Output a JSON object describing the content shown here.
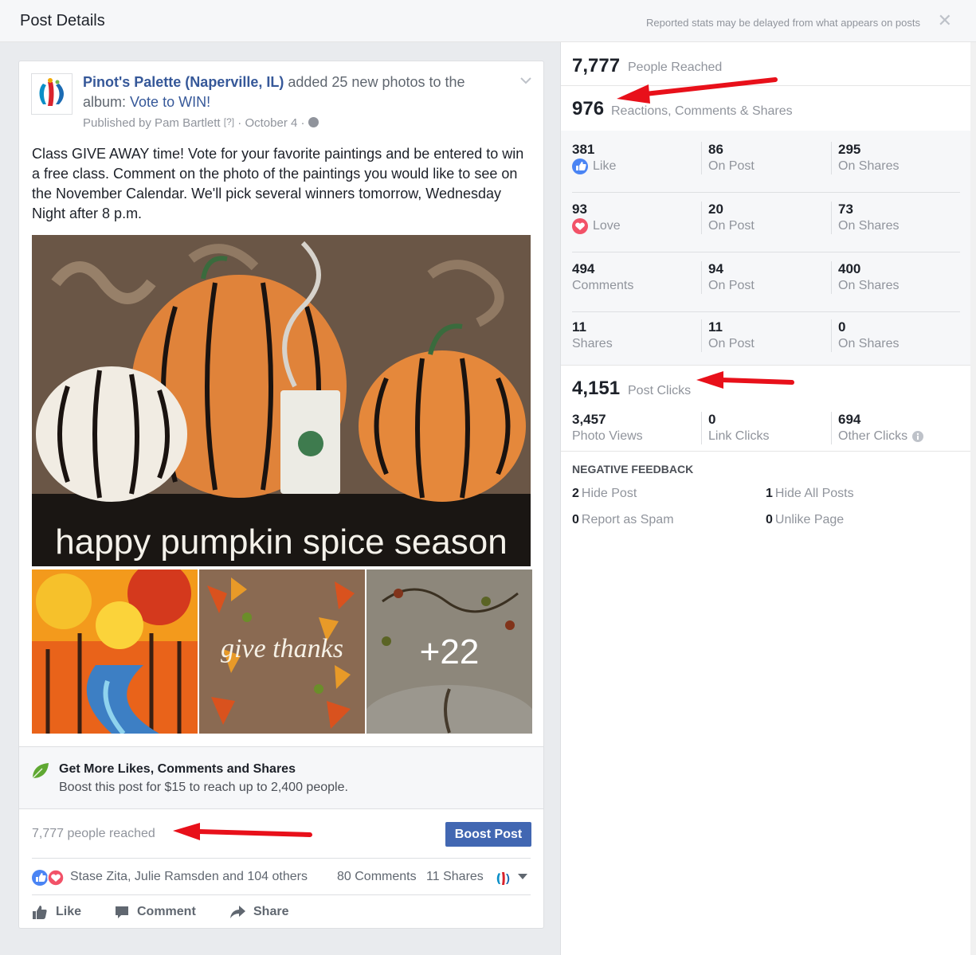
{
  "dialog": {
    "title": "Post Details",
    "note": "Reported stats may be delayed from what appears on posts",
    "close_glyph": "✕"
  },
  "post": {
    "page_name": "Pinot's Palette (Naperville, IL)",
    "action_text": " added 25 new photos to the album: ",
    "album_name": "Vote to WIN!",
    "published_by": "Published by Pam Bartlett",
    "help_mark": "[?]",
    "date": "October 4",
    "body": "Class GIVE AWAY time! Vote for your favorite paintings and be entered to win a free class. Comment on the photo of the paintings you would like to see on the November Calendar. We'll pick several winners tomorrow, Wednesday Night after 8 p.m.",
    "photo_main_caption": "happy pumpkin spice season",
    "photo_thumb2_caption": "give thanks",
    "more_photos": "+22",
    "boost_title": "Get More Likes, Comments and Shares",
    "boost_sub": "Boost this post for $15 to reach up to 2,400 people.",
    "reach": "7,777 people reached",
    "boost_button": "Boost Post",
    "reaction_names": "Stase Zita, Julie Ramsden and 104 others",
    "comments_count": "80 Comments",
    "shares_count": "11 Shares",
    "actions": {
      "like": "Like",
      "comment": "Comment",
      "share": "Share"
    }
  },
  "stats": {
    "reached": {
      "value": "7,777",
      "label": "People Reached"
    },
    "engagement": {
      "value": "976",
      "label": "Reactions, Comments & Shares"
    },
    "rows": [
      {
        "total": "381",
        "label": "Like",
        "icon": "like-icon",
        "on_post": "86",
        "on_shares": "295"
      },
      {
        "total": "93",
        "label": "Love",
        "icon": "love-icon",
        "on_post": "20",
        "on_shares": "73"
      },
      {
        "total": "494",
        "label": "Comments",
        "icon": "",
        "on_post": "94",
        "on_shares": "400"
      },
      {
        "total": "11",
        "label": "Shares",
        "icon": "",
        "on_post": "11",
        "on_shares": "0"
      }
    ],
    "on_post_label": "On Post",
    "on_shares_label": "On Shares",
    "clicks": {
      "value": "4,151",
      "label": "Post Clicks"
    },
    "click_breakdown": [
      {
        "value": "3,457",
        "label": "Photo Views"
      },
      {
        "value": "0",
        "label": "Link Clicks"
      },
      {
        "value": "694",
        "label": "Other Clicks"
      }
    ],
    "negative_title": "NEGATIVE FEEDBACK",
    "negative": [
      {
        "value": "2",
        "label": "Hide Post"
      },
      {
        "value": "1",
        "label": "Hide All Posts"
      },
      {
        "value": "0",
        "label": "Report as Spam"
      },
      {
        "value": "0",
        "label": "Unlike Page"
      }
    ]
  },
  "colors": {
    "link_blue": "#365899",
    "button_blue": "#4267b2",
    "annotation_red": "#e8101a"
  }
}
